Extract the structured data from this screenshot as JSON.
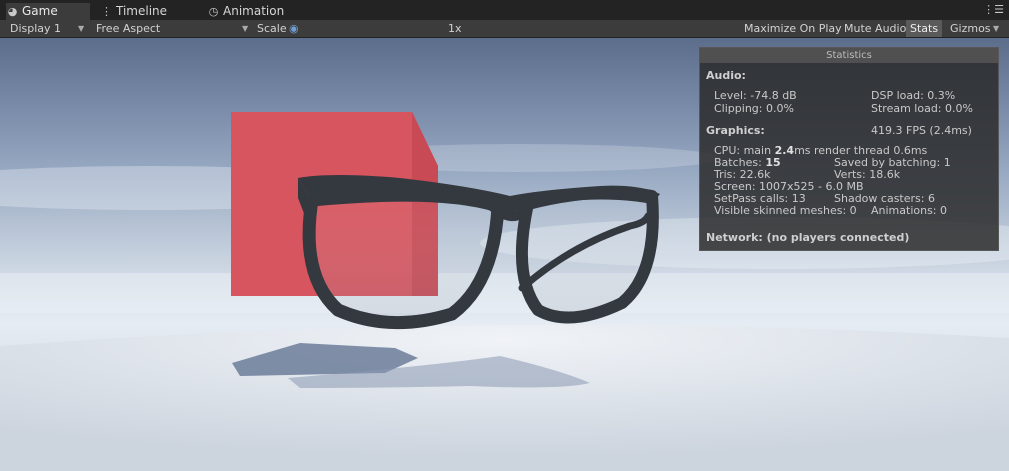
{
  "tabs": [
    {
      "label": "Game",
      "icon": "pacman-icon"
    },
    {
      "label": "Timeline",
      "icon": "timeline-icon"
    },
    {
      "label": "Animation",
      "icon": "clock-icon"
    }
  ],
  "toolbar": {
    "display": "Display 1",
    "aspect": "Free Aspect",
    "scale_label": "Scale",
    "scale_value": "1x",
    "maximize": "Maximize On Play",
    "mute": "Mute Audio",
    "stats": "Stats",
    "gizmos": "Gizmos"
  },
  "stats": {
    "title": "Statistics",
    "audio_header": "Audio:",
    "level": "Level: -74.8 dB",
    "dsp_load": "DSP load: 0.3%",
    "clipping": "Clipping: 0.0%",
    "stream_load": "Stream load: 0.0%",
    "graphics_header": "Graphics:",
    "fps": "419.3 FPS (2.4ms)",
    "cpu_prefix": "CPU: main ",
    "cpu_main": "2.4",
    "cpu_suffix": "ms  render thread 0.6ms",
    "batches_prefix": "Batches: ",
    "batches": "15",
    "saved_batching": "Saved by batching: 1",
    "tris": "Tris: 22.6k",
    "verts": "Verts: 18.6k",
    "screen": "Screen: 1007x525 - 6.0 MB",
    "setpass": "SetPass calls: 13",
    "shadow_casters": "Shadow casters: 6",
    "skinned": "Visible skinned meshes: 0",
    "animations": "Animations: 0",
    "network": "Network: (no players connected)"
  },
  "colors": {
    "cube": "#d7555f",
    "glasses": "#34383f",
    "accent_scale": "#6f9fd0"
  }
}
